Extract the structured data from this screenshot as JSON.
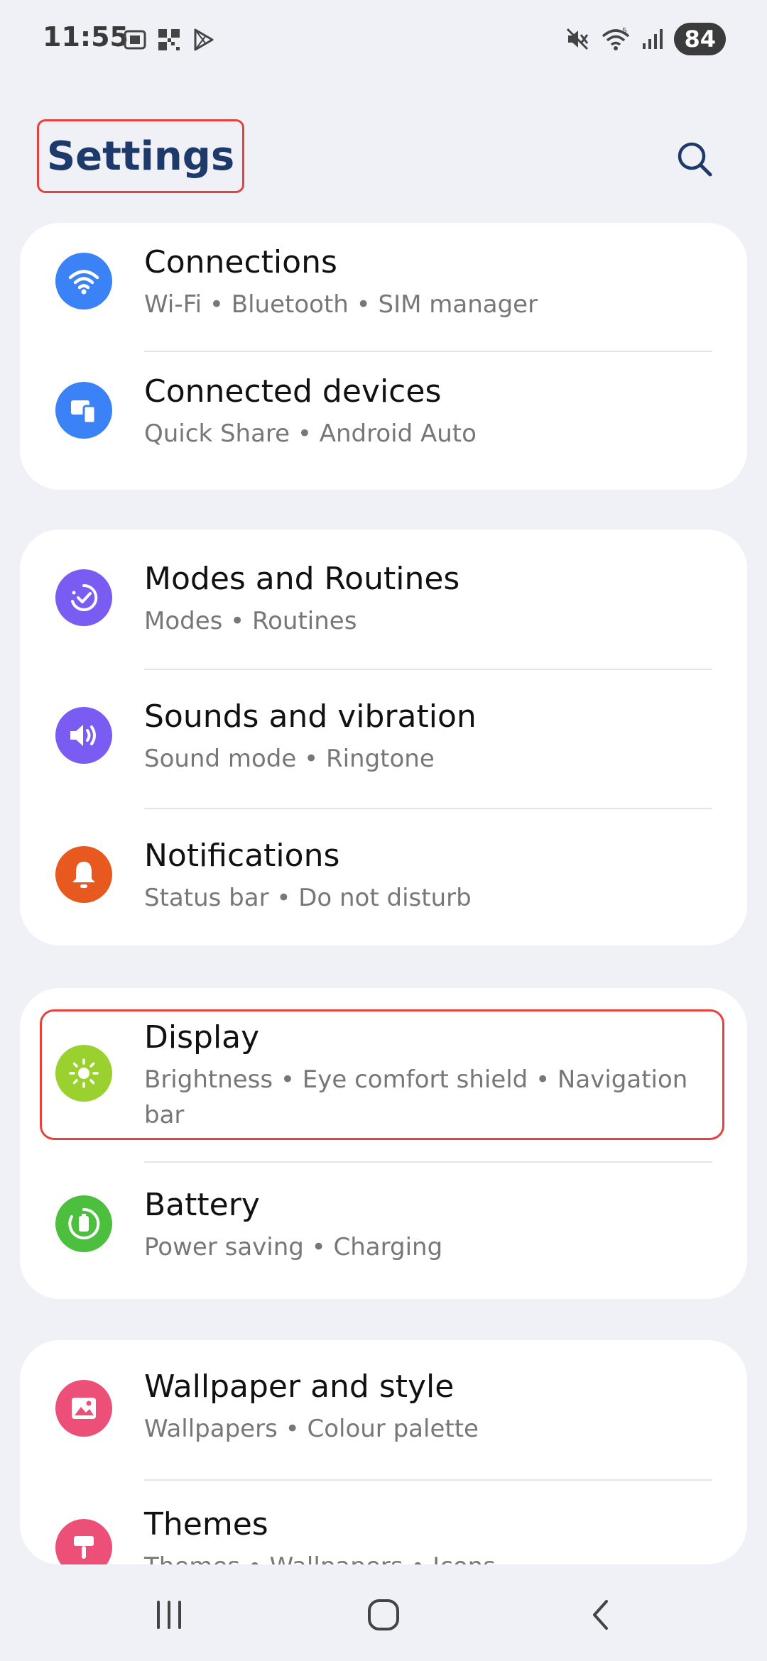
{
  "status_bar": {
    "time": "11:55",
    "battery": "84",
    "left_icons": [
      "screenshot-icon",
      "qr-icon",
      "play-store-icon"
    ],
    "right_icons": [
      "mute-icon",
      "wifi-icon",
      "signal-icon"
    ],
    "wifi_badge": "5"
  },
  "header": {
    "title": "Settings",
    "search_icon": "search-icon"
  },
  "sections": [
    {
      "items": [
        {
          "title": "Connections",
          "subtitle": "Wi-Fi  •  Bluetooth  •  SIM manager",
          "icon": "wifi-icon",
          "color": "#3b82f6"
        },
        {
          "title": "Connected devices",
          "subtitle": "Quick Share  •  Android Auto",
          "icon": "devices-icon",
          "color": "#3b82f6"
        }
      ]
    },
    {
      "items": [
        {
          "title": "Modes and Routines",
          "subtitle": "Modes  •  Routines",
          "icon": "routines-icon",
          "color": "#7a5cf2"
        },
        {
          "title": "Sounds and vibration",
          "subtitle": "Sound mode  •  Ringtone",
          "icon": "speaker-icon",
          "color": "#7a5cf2"
        },
        {
          "title": "Notifications",
          "subtitle": "Status bar  •  Do not disturb",
          "icon": "bell-icon",
          "color": "#e8591f"
        }
      ]
    },
    {
      "items": [
        {
          "title": "Display",
          "subtitle": "Brightness  •  Eye comfort shield  •  Navigation bar",
          "icon": "sun-icon",
          "color": "#9bd12e"
        },
        {
          "title": "Battery",
          "subtitle": "Power saving  •  Charging",
          "icon": "battery-icon",
          "color": "#4cbf3f"
        }
      ]
    },
    {
      "items": [
        {
          "title": "Wallpaper and style",
          "subtitle": "Wallpapers  •  Colour palette",
          "icon": "wallpaper-icon",
          "color": "#ec4f78"
        },
        {
          "title": "Themes",
          "subtitle": "Themes  •  Wallpapers  •  Icons",
          "icon": "themes-icon",
          "color": "#ec4f78"
        }
      ]
    }
  ],
  "nav": {
    "recents": "recents-icon",
    "home": "home-icon",
    "back": "back-icon"
  }
}
